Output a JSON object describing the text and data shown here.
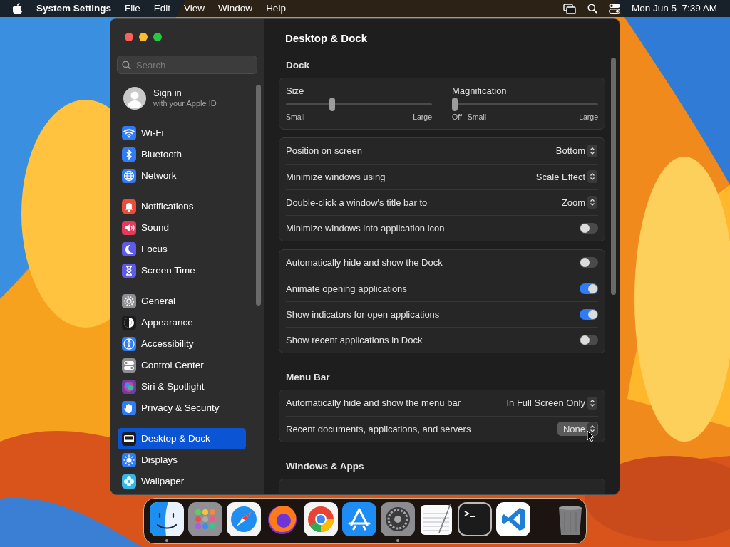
{
  "menu_bar": {
    "app": "System Settings",
    "menus": [
      "File",
      "Edit",
      "View",
      "Window",
      "Help"
    ],
    "clock": "Mon Jun 5  7:39 AM"
  },
  "sidebar": {
    "search": {
      "placeholder": "Search"
    },
    "account": {
      "title": "Sign in",
      "subtitle": "with your Apple ID"
    },
    "groups": [
      [
        {
          "label": "Wi-Fi",
          "selected": false,
          "color": "#2f7cf6"
        },
        {
          "label": "Bluetooth",
          "selected": false,
          "color": "#2f7cf6"
        },
        {
          "label": "Network",
          "selected": false,
          "color": "#2f7cf6"
        }
      ],
      [
        {
          "label": "Notifications",
          "selected": false,
          "color": "#eb4d3d"
        },
        {
          "label": "Sound",
          "selected": false,
          "color": "#e8395c"
        },
        {
          "label": "Focus",
          "selected": false,
          "color": "#5e5ce6"
        },
        {
          "label": "Screen Time",
          "selected": false,
          "color": "#5e5ce6"
        }
      ],
      [
        {
          "label": "General",
          "selected": false,
          "color": "#8e8e93"
        },
        {
          "label": "Appearance",
          "selected": false,
          "color": "#1c1c1e"
        },
        {
          "label": "Accessibility",
          "selected": false,
          "color": "#2f7cf6"
        },
        {
          "label": "Control Center",
          "selected": false,
          "color": "#8e8e93"
        },
        {
          "label": "Siri & Spotlight",
          "selected": false,
          "color": "#6b3fa0"
        },
        {
          "label": "Privacy & Security",
          "selected": false,
          "color": "#2f7cf6"
        }
      ],
      [
        {
          "label": "Desktop & Dock",
          "selected": true,
          "color": "#1c1c1e"
        },
        {
          "label": "Displays",
          "selected": false,
          "color": "#2f7cf6"
        },
        {
          "label": "Wallpaper",
          "selected": false,
          "color": "#38b6e8"
        }
      ]
    ]
  },
  "main": {
    "title": "Desktop & Dock",
    "sections": [
      {
        "heading": "Dock",
        "cards": [
          {
            "rows": [
              {
                "kind": "sliders",
                "sliders": [
                  {
                    "label": "Size",
                    "level": 0.31,
                    "ticks": [
                      "Small",
                      "Large"
                    ]
                  },
                  {
                    "label": "Magnification",
                    "level": 0.0,
                    "ticks": [
                      "Off",
                      "Small",
                      "Large"
                    ]
                  }
                ]
              }
            ]
          },
          {
            "rows": [
              {
                "kind": "popup",
                "label": "Position on screen",
                "value": "Bottom",
                "highlighted": false
              },
              {
                "kind": "popup",
                "label": "Minimize windows using",
                "value": "Scale Effect",
                "highlighted": false
              },
              {
                "kind": "popup",
                "label": "Double-click a window's title bar to",
                "value": "Zoom",
                "highlighted": false
              },
              {
                "kind": "toggle",
                "label": "Minimize windows into application icon",
                "on": false
              }
            ]
          },
          {
            "rows": [
              {
                "kind": "toggle",
                "label": "Automatically hide and show the Dock",
                "on": false
              },
              {
                "kind": "toggle",
                "label": "Animate opening applications",
                "on": true
              },
              {
                "kind": "toggle",
                "label": "Show indicators for open applications",
                "on": true
              },
              {
                "kind": "toggle",
                "label": "Show recent applications in Dock",
                "on": false
              }
            ]
          }
        ]
      },
      {
        "heading": "Menu Bar",
        "cards": [
          {
            "rows": [
              {
                "kind": "popup",
                "label": "Automatically hide and show the menu bar",
                "value": "In Full Screen Only",
                "highlighted": false
              },
              {
                "kind": "popup",
                "label": "Recent documents, applications, and servers",
                "value": "None",
                "highlighted": true
              }
            ]
          }
        ]
      },
      {
        "heading": "Windows & Apps",
        "partial_card": true
      }
    ]
  },
  "dock": {
    "apps": [
      {
        "running": true
      },
      {
        "running": false
      },
      {
        "running": false
      },
      {
        "running": false
      },
      {
        "running": false
      },
      {
        "running": false
      },
      {
        "running": true
      },
      {
        "running": false
      },
      {
        "running": false
      },
      {
        "running": false
      }
    ],
    "trash": {
      "running": false
    }
  }
}
